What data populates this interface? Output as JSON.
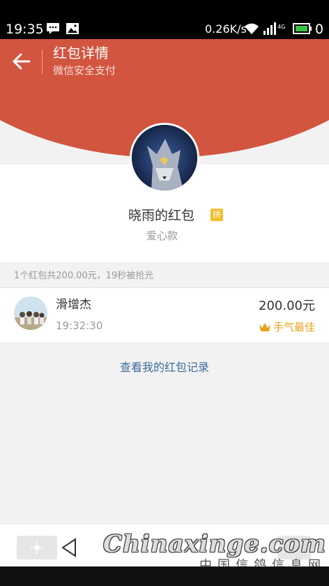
{
  "status_bar": {
    "time": "19:35",
    "speed": "0.26K/s",
    "network": "4G",
    "battery_number": "0"
  },
  "header": {
    "title": "红包详情",
    "subtitle": "微信安全支付"
  },
  "packet": {
    "title": "晓雨的红包",
    "badge": "拼",
    "description": "爱心款"
  },
  "summary": "1个红包共200.00元，19秒被抢光",
  "receivers": [
    {
      "name": "滑增杰",
      "time": "19:32:30",
      "amount": "200.00元",
      "best_label": "手气最佳"
    }
  ],
  "records_link": "查看我的红包记录",
  "watermark": {
    "main": "Chinaxinge.com",
    "sub": "中国信鸽信息网"
  },
  "colors": {
    "header_red": "#d2553f",
    "link_blue": "#3e6c9c",
    "gold": "#e8a21f",
    "badge_yellow": "#f2c031"
  }
}
